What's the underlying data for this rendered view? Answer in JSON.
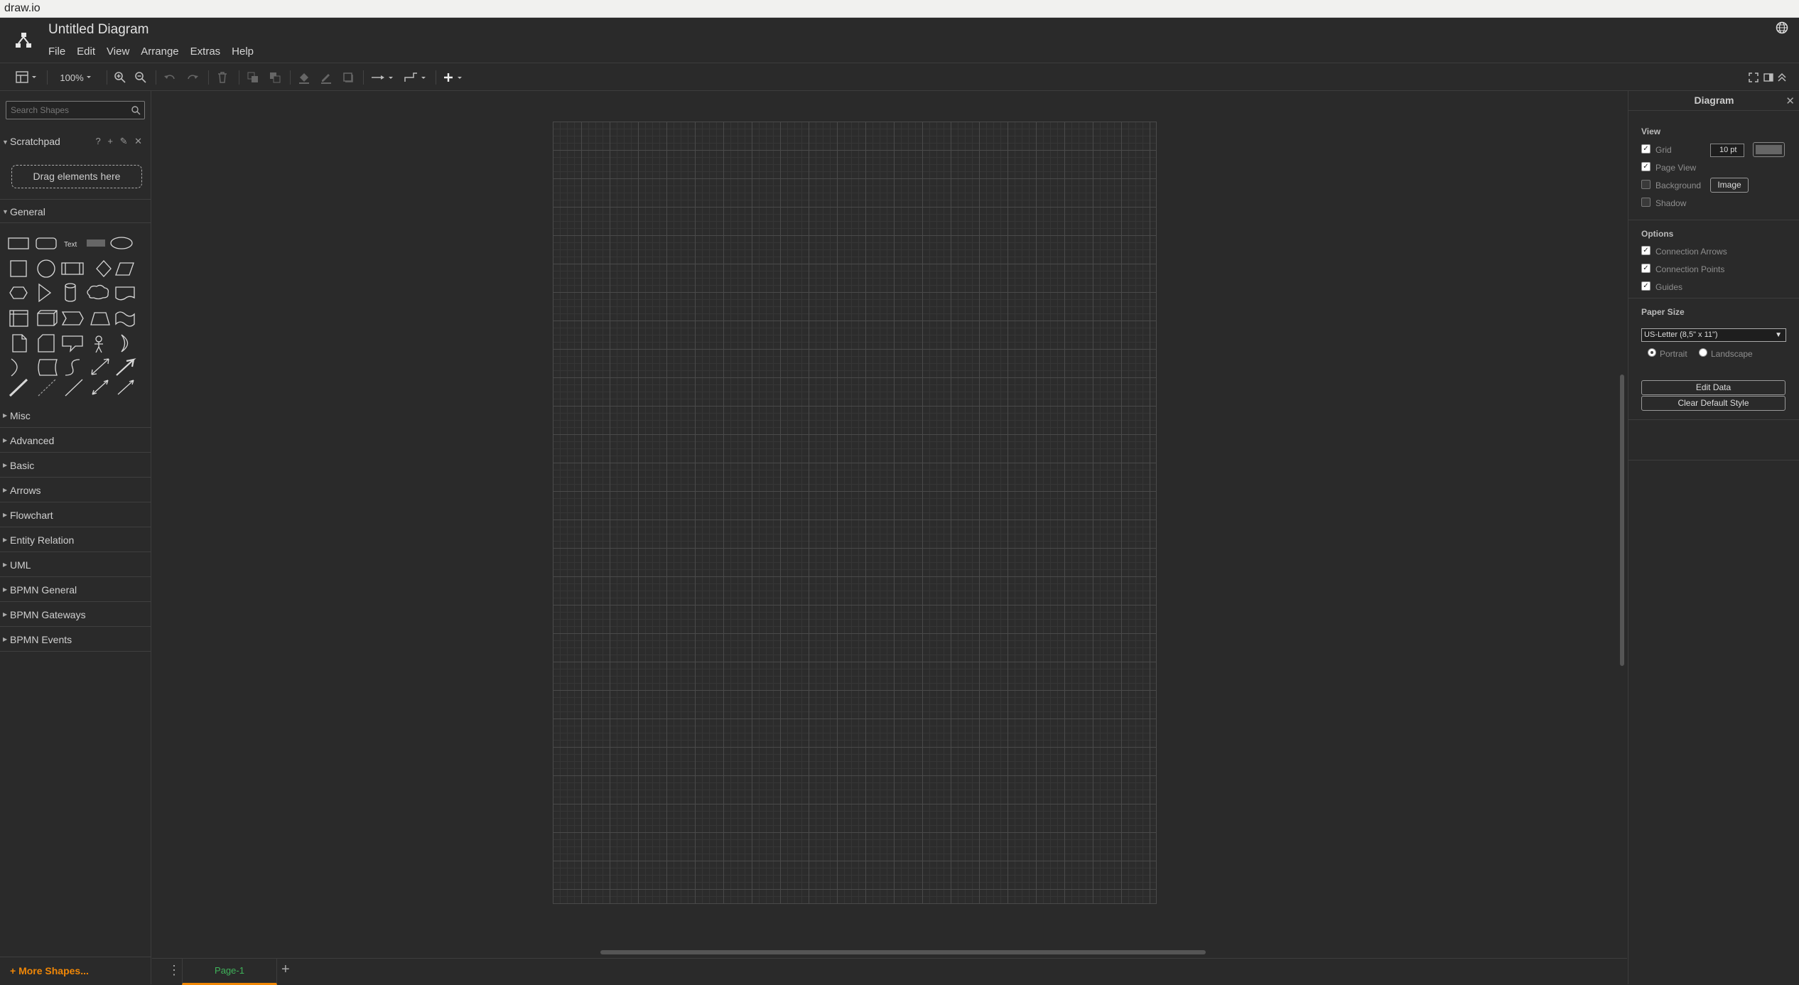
{
  "window": {
    "title": "draw.io"
  },
  "header": {
    "doc_title": "Untitled Diagram",
    "menu": [
      "File",
      "Edit",
      "View",
      "Arrange",
      "Extras",
      "Help"
    ]
  },
  "toolbar": {
    "zoom": "100%"
  },
  "sidebar": {
    "search_placeholder": "Search Shapes",
    "scratchpad": {
      "label": "Scratchpad",
      "tools": "? + ✎ ✕",
      "drop_hint": "Drag elements here"
    },
    "general_label": "General",
    "sections": [
      "Misc",
      "Advanced",
      "Basic",
      "Arrows",
      "Flowchart",
      "Entity Relation",
      "UML",
      "BPMN General",
      "BPMN Gateways",
      "BPMN Events"
    ],
    "more_shapes": "+ More Shapes..."
  },
  "pages": {
    "tabs": [
      "Page-1"
    ],
    "active": "Page-1"
  },
  "format_panel": {
    "title": "Diagram",
    "view": {
      "heading": "View",
      "grid": {
        "label": "Grid",
        "checked": true,
        "size": "10 pt"
      },
      "page_view": {
        "label": "Page View",
        "checked": true
      },
      "background": {
        "label": "Background",
        "checked": false,
        "button": "Image"
      },
      "shadow": {
        "label": "Shadow",
        "checked": false
      }
    },
    "options": {
      "heading": "Options",
      "connection_arrows": {
        "label": "Connection Arrows",
        "checked": true
      },
      "connection_points": {
        "label": "Connection Points",
        "checked": true
      },
      "guides": {
        "label": "Guides",
        "checked": true
      }
    },
    "paper": {
      "heading": "Paper Size",
      "size": "US-Letter (8,5\" x 11\")",
      "portrait": "Portrait",
      "landscape": "Landscape",
      "orientation": "Portrait"
    },
    "buttons": {
      "edit_data": "Edit Data",
      "clear_style": "Clear Default Style"
    }
  },
  "colors": {
    "accent": "#f08705",
    "active_tab_text": "#3fb35a",
    "background": "#2a2a2a"
  }
}
